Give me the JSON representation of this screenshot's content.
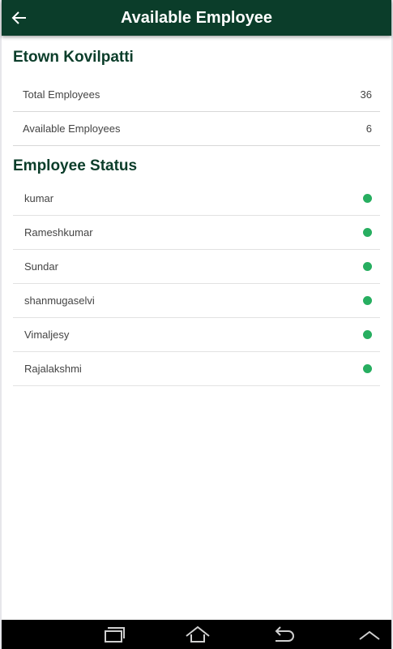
{
  "app_bar": {
    "title": "Available Employee",
    "back_icon": "arrow-left-icon"
  },
  "summary": {
    "title": "Etown Kovilpatti",
    "rows": [
      {
        "label": "Total Employees",
        "value": "36"
      },
      {
        "label": "Available Employees",
        "value": "6"
      }
    ]
  },
  "status": {
    "title": "Employee Status",
    "employees": [
      {
        "name": "kumar",
        "status_icon": "green-dot-icon"
      },
      {
        "name": "Rameshkumar",
        "status_icon": "green-dot-icon"
      },
      {
        "name": "Sundar",
        "status_icon": "green-dot-icon"
      },
      {
        "name": "shanmugaselvi",
        "status_icon": "green-dot-icon"
      },
      {
        "name": "Vimaljesy",
        "status_icon": "green-dot-icon"
      },
      {
        "name": "Rajalakshmi",
        "status_icon": "green-dot-icon"
      }
    ]
  },
  "nav_bar": {
    "icons": [
      "recent-apps-icon",
      "home-icon",
      "back-icon",
      "chevron-up-icon"
    ]
  },
  "colors": {
    "primary": "#0b3d2a",
    "status_available": "#27ae60"
  }
}
